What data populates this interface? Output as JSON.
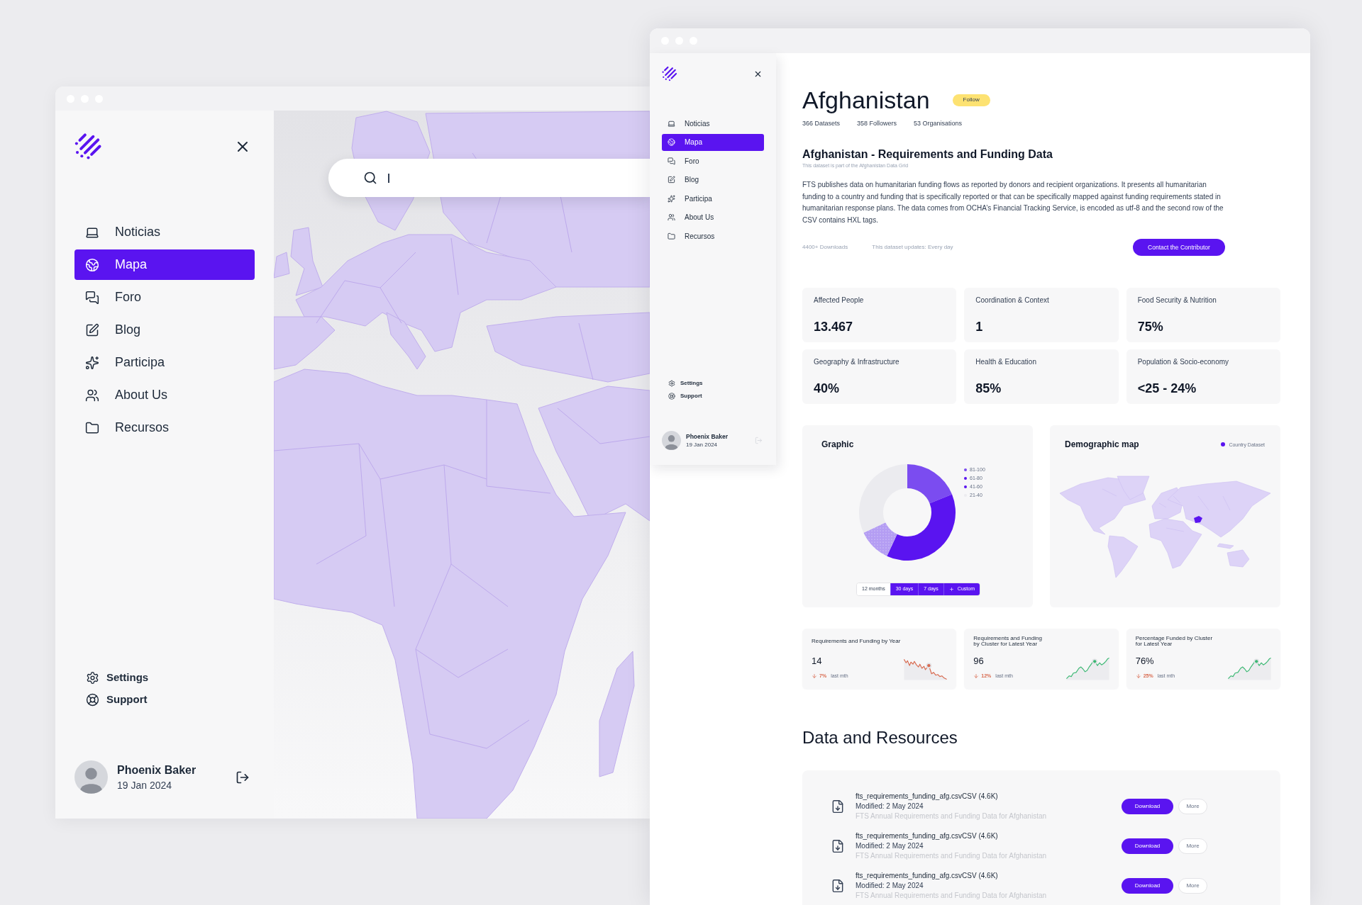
{
  "map_window": {
    "sidebar": {
      "nav": [
        {
          "label": "Noticias",
          "selected": false
        },
        {
          "label": "Mapa",
          "selected": true
        },
        {
          "label": "Foro",
          "selected": false
        },
        {
          "label": "Blog",
          "selected": false
        },
        {
          "label": "Participa",
          "selected": false
        },
        {
          "label": "About Us",
          "selected": false
        },
        {
          "label": "Recursos",
          "selected": false
        }
      ],
      "links": [
        "Settings",
        "Support"
      ],
      "user": {
        "name": "Phoenix Baker",
        "date": "19 Jan 2024"
      }
    }
  },
  "dataset_window": {
    "sidebar": {
      "nav": [
        {
          "label": "Noticias",
          "selected": false
        },
        {
          "label": "Mapa",
          "selected": true
        },
        {
          "label": "Foro",
          "selected": false
        },
        {
          "label": "Blog",
          "selected": false
        },
        {
          "label": "Participa",
          "selected": false
        },
        {
          "label": "About Us",
          "selected": false
        },
        {
          "label": "Recursos",
          "selected": false
        }
      ],
      "links": [
        "Settings",
        "Support"
      ],
      "user": {
        "name": "Phoenix Baker",
        "date": "19 Jan 2024"
      }
    },
    "country": {
      "name": "Afghanistan",
      "follow_button": "Follow",
      "stats": [
        "366 Datasets",
        "358 Followers",
        "53 Organisations"
      ]
    },
    "dataset": {
      "title": "Afghanistan - Requirements and Funding Data",
      "subtitle": "This dataset is part of the Afghanistan Data Grid",
      "description": "FTS publishes data on humanitarian funding flows as reported by donors and recipient organizations. It presents all humanitarian funding to a country and funding that is specifically reported or that can be specifically mapped against funding requirements stated in humanitarian response plans. The data comes from OCHA’s Financial Tracking Service, is encoded as utf-8 and the second row of the CSV contains HXL tags.",
      "downloads": "4400+ Downloads",
      "updates": "This dataset updates: Every day",
      "contact_button": "Contact the Contributor"
    },
    "indicators": [
      {
        "label": "Affected People",
        "value": "13.467"
      },
      {
        "label": "Coordination & Context",
        "value": "1"
      },
      {
        "label": "Food Security & Nutrition",
        "value": "75%"
      },
      {
        "label": "Geography & Infrastructure",
        "value": "40%"
      },
      {
        "label": "Health & Education",
        "value": "85%"
      },
      {
        "label": "Population & Socio-economy",
        "value": "<25 - 24%"
      }
    ],
    "graphic": {
      "title": "Graphic",
      "legend": [
        {
          "label": "81-100",
          "color": "#7b4cf0"
        },
        {
          "label": "61-80",
          "color": "#5a14f0"
        },
        {
          "label": "41-60",
          "color": "#5a14f0"
        },
        {
          "label": "21-40",
          "color": "#ebebef"
        }
      ],
      "periods": [
        {
          "label": "12 months",
          "selected": true,
          "kind": "preset"
        },
        {
          "label": "30 days",
          "selected": false,
          "kind": "preset"
        },
        {
          "label": "7 days",
          "selected": false,
          "kind": "preset"
        },
        {
          "label": "Custom",
          "selected": false,
          "kind": "custom"
        }
      ]
    },
    "demographic_map": {
      "title": "Demographic map",
      "legend": {
        "label": "Country Dataset",
        "color": "#5a14f0"
      }
    },
    "metrics": [
      {
        "title": "Requirements and Funding by Year",
        "value": "14",
        "change": "7%",
        "period": "last mth",
        "kind": "falling"
      },
      {
        "title": "Requirements and Funding\nby Cluster for Latest Year",
        "value": "96",
        "change": "12%",
        "period": "last mth",
        "kind": "rising"
      },
      {
        "title": "Percentage Funded by Cluster\nfor Latest Year",
        "value": "76%",
        "change": "25%",
        "period": "last mth",
        "kind": "rising"
      }
    ],
    "resources": {
      "title": "Data and Resources",
      "files": [
        {
          "name": "fts_requirements_funding_afg.csvCSV (4.6K)",
          "modified": "Modified: 2 May 2024",
          "description": "FTS Annual Requirements and Funding Data for Afghanistan",
          "download_button": "Download",
          "more_button": "More"
        },
        {
          "name": "fts_requirements_funding_afg.csvCSV (4.6K)",
          "modified": "Modified: 2 May 2024",
          "description": "FTS Annual Requirements and Funding Data for Afghanistan",
          "download_button": "Download",
          "more_button": "More"
        },
        {
          "name": "fts_requirements_funding_afg.csvCSV (4.6K)",
          "modified": "Modified: 2 May 2024",
          "description": "FTS Annual Requirements and Funding Data for Afghanistan",
          "download_button": "Download",
          "more_button": "More"
        }
      ]
    }
  }
}
